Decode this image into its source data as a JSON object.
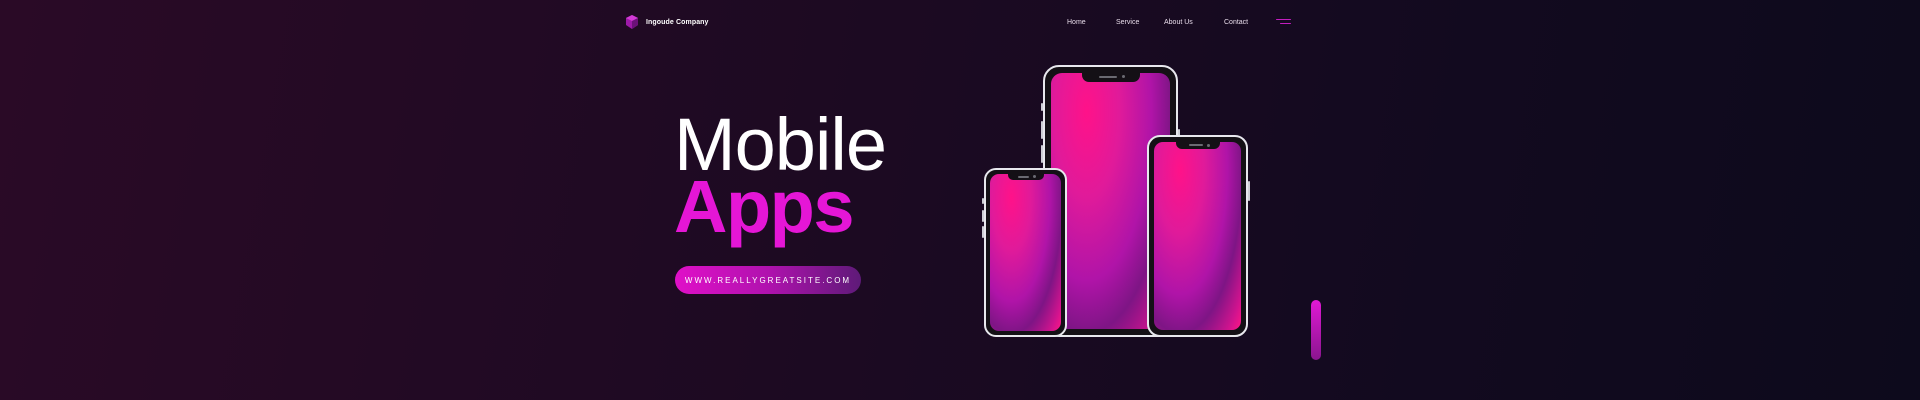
{
  "header": {
    "brand": "Ingoude Company",
    "nav": [
      "Home",
      "Service",
      "About Us",
      "Contact"
    ]
  },
  "hero": {
    "title_line1": "Mobile",
    "title_line2": "Apps",
    "cta_label": "WWW.REALLYGREATSITE.COM"
  },
  "icons": {
    "logo": "cube-logo-icon",
    "menu": "menu-icon"
  },
  "colors": {
    "accent": "#e516d6",
    "background_dark": "#1a0a22",
    "cta_start": "#e010c8",
    "cta_end": "#5e1a78",
    "screen_pink": "#ff0f8a"
  }
}
